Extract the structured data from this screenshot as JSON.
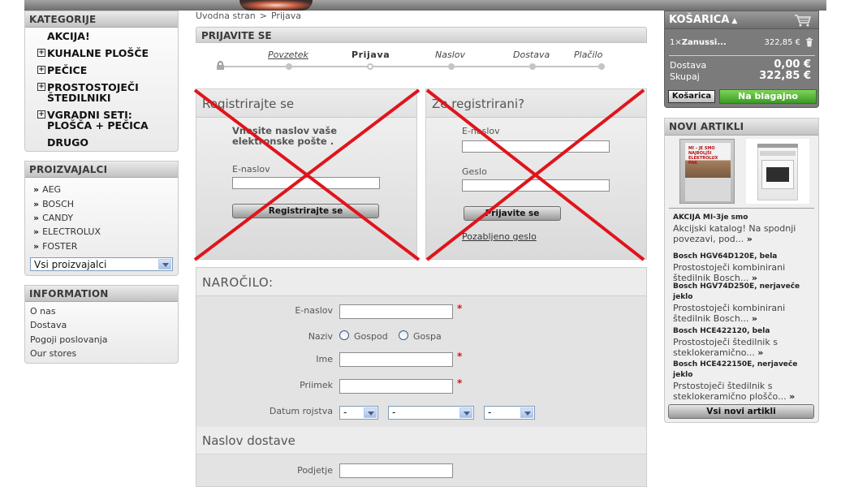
{
  "categories": {
    "title": "KATEGORIJE",
    "items": [
      {
        "label": "AKCIJA!",
        "expandable": false
      },
      {
        "label": "KUHALNE PLOŠČE",
        "expandable": true
      },
      {
        "label": "PEČICE",
        "expandable": true
      },
      {
        "label": "PROSTOSTOJEČI ŠTEDILNIKI",
        "expandable": true
      },
      {
        "label": "VGRADNI SETI: PLOŠČA + PEČICA",
        "expandable": true
      },
      {
        "label": "DRUGO",
        "expandable": false
      }
    ]
  },
  "manufacturers": {
    "title": "PROIZVAJALCI",
    "items": [
      "AEG",
      "BOSCH",
      "CANDY",
      "ELECTROLUX",
      "FOSTER"
    ],
    "select_value": "Vsi proizvajalci"
  },
  "information": {
    "title": "INFORMATION",
    "items": [
      "O nas",
      "Dostava",
      "Pogoji poslovanja",
      "Our stores"
    ]
  },
  "breadcrumb": {
    "home": "Uvodna stran",
    "sep": ">",
    "current": "Prijava"
  },
  "login": {
    "title": "PRIJAVITE SE",
    "steps": [
      "Povzetek",
      "Prijava",
      "Naslov",
      "Dostava",
      "Plačilo"
    ],
    "current_step": "Prijava"
  },
  "register": {
    "title": "Registrirajte se",
    "intro": "Vnesite naslov vaše elektronske pošte .",
    "email_label": "E-naslov",
    "button": "Registrirajte se"
  },
  "existing": {
    "title": "Že registrirani?",
    "email_label": "E-naslov",
    "password_label": "Geslo",
    "button": "Prijavite se",
    "forgot": "Pozabljeno geslo"
  },
  "order": {
    "title": "NAROČILO:",
    "email_label": "E-naslov",
    "title_label": "Naziv",
    "mr": "Gospod",
    "mrs": "Gospa",
    "first_name_label": "Ime",
    "last_name_label": "Priimek",
    "dob_label": "Datum rojstva",
    "dob_day": "-",
    "dob_month": "-",
    "dob_year": "-",
    "required_mark": "*",
    "shipping_title": "Naslov dostave",
    "company_label": "Podjetje"
  },
  "cart": {
    "title": "KOŠARICA",
    "line_qty": "1×",
    "line_name": "Zanussi...",
    "line_price": "322,85 €",
    "shipping_label": "Dostava",
    "shipping_value": "0,00 €",
    "total_label": "Skupaj",
    "total_value": "322,85 €",
    "cart_button": "Košarica",
    "checkout_button": "Na blagajno"
  },
  "new_products": {
    "title": "NOVI ARTIKLI",
    "catalog_text": "MI – JE SMO NAJBOLJŠI ELEKTROLUX PAK",
    "items": [
      {
        "title": "AKCIJA MI-3je smo",
        "desc": "Akcijski katalog! Na spodnji povezavi, pod..."
      },
      {
        "title": "Bosch HGV64D120E, bela",
        "desc": "Prostostoječi kombinirani štedilnik Bosch..."
      },
      {
        "title": "Bosch HGV74D250E, nerjaveče jeklo",
        "desc": "Prostostoječi kombinirani štedilnik Bosch..."
      },
      {
        "title": "Bosch HCE422120, bela",
        "desc": "Prostostoječi štedilnik s steklokeramično..."
      },
      {
        "title": "Bosch HCE422150E, nerjaveče jeklo",
        "desc": "Prstostoječi štedilnik s steklokeramično ploščo..."
      }
    ],
    "more_glyph": "»",
    "all_button": "Vsi novi artikli"
  },
  "colors": {
    "cross": "#e0141c",
    "checkout": "#3a9a25",
    "required": "#d9141a"
  },
  "icons": {
    "cart": "shopping-cart-icon",
    "trash": "trash-icon",
    "lock": "lock-icon",
    "plus": "plus-icon",
    "arrow": "double-chevron-right-icon"
  }
}
